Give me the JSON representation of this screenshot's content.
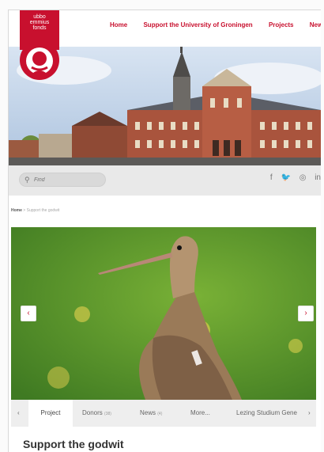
{
  "logo": {
    "line1": "ubbo",
    "line2": "emmius",
    "line3": "fonds"
  },
  "nav": [
    "Home",
    "Support the University of Groningen",
    "Projects",
    "News"
  ],
  "search": {
    "placeholder": "Find"
  },
  "social": [
    "f",
    "🐦",
    "◎",
    "in"
  ],
  "breadcrumb": {
    "home": "Home",
    "sep": " > ",
    "current": "Support the godwit"
  },
  "slider": {
    "prev": "‹",
    "next": "›"
  },
  "tabs": {
    "left_arrow": "‹",
    "right_arrow": "›",
    "items": [
      {
        "label": "Project",
        "count": ""
      },
      {
        "label": "Donors",
        "count": "(38)"
      },
      {
        "label": "News",
        "count": "(4)"
      },
      {
        "label": "More...",
        "count": ""
      },
      {
        "label": "Lezing Studium Gene",
        "count": ""
      }
    ]
  },
  "page_title": "Support the godwit",
  "colors": {
    "brand": "#c8102e",
    "sky": "#c9d9ee",
    "grass": "#5f9a2c"
  }
}
